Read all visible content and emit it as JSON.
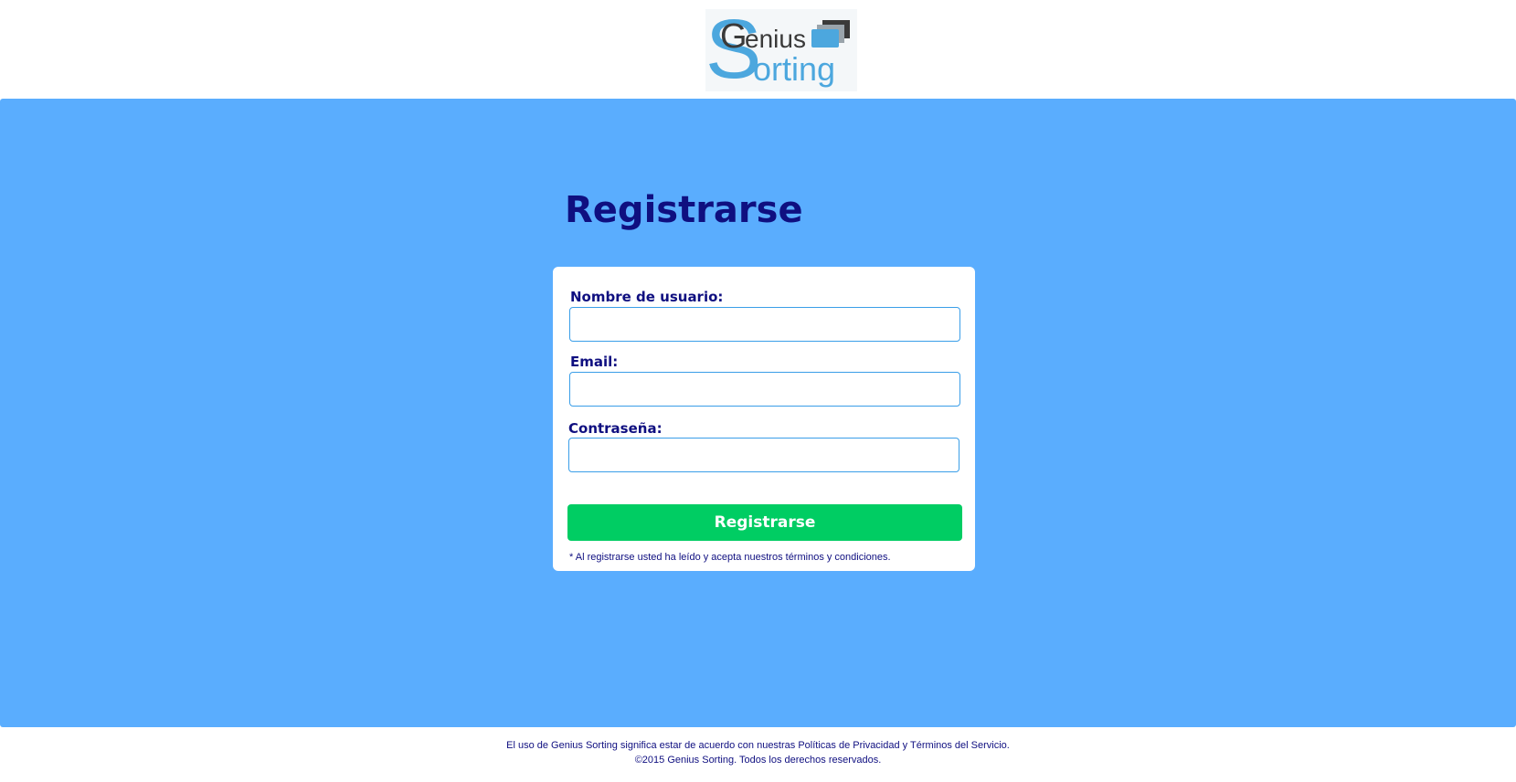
{
  "brand": {
    "logo_text_line1": "Genius",
    "logo_text_line2": "Sorting",
    "primary_color": "#4ca7de",
    "dark_color": "#3a3a3a"
  },
  "page": {
    "title": "Registrarse",
    "background_color": "#5aadfe",
    "title_color": "#0f0f80"
  },
  "form": {
    "username_label": "Nombre de usuario:",
    "username_value": "",
    "email_label": "Email:",
    "email_value": "",
    "password_label": "Contraseña:",
    "password_value": "",
    "submit_label": "Registrarse",
    "submit_color": "#00cd63",
    "terms_note": "* Al registrarse usted ha leído y acepta nuestros términos y condiciones."
  },
  "footer": {
    "line1_prefix": "El uso de Genius Sorting significa estar de acuerdo con nuestras ",
    "privacy_link": "Políticas de Privacidad",
    "line1_middle": " y ",
    "terms_link": "Términos del Servicio",
    "line1_suffix": ".",
    "copyright": "©2015 Genius Sorting. Todos los derechos reservados."
  }
}
